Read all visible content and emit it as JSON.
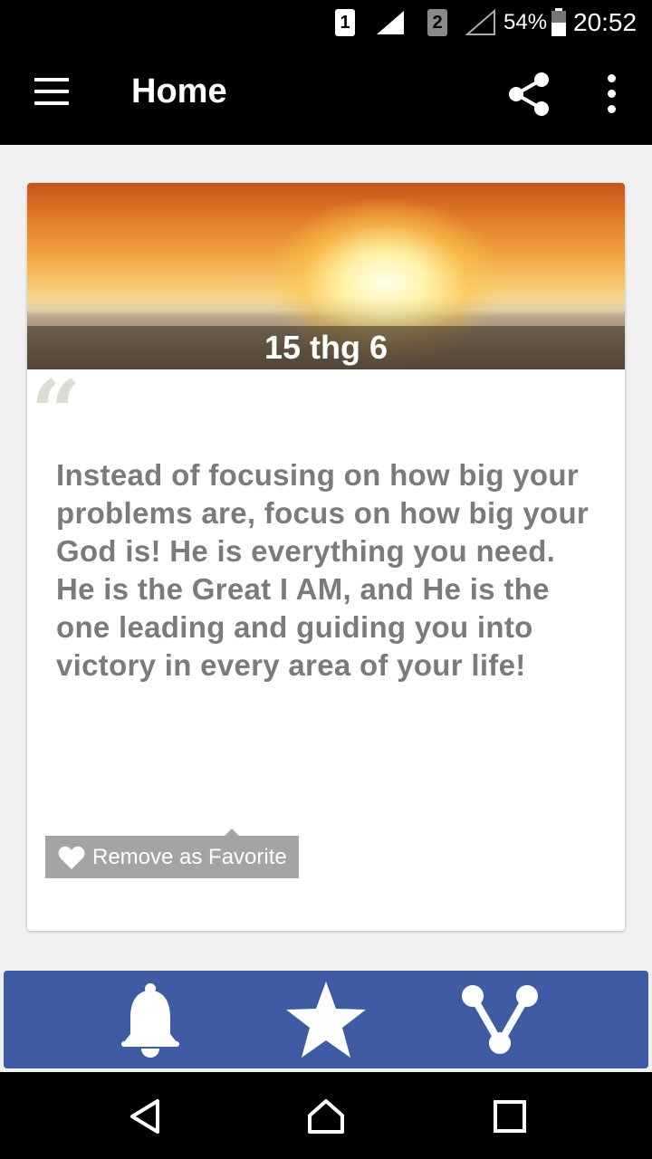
{
  "status_bar": {
    "sim1": "1",
    "sim2": "2",
    "battery": "54%",
    "time": "20:52"
  },
  "app_bar": {
    "title": "Home",
    "icons": [
      "menu-icon",
      "share-icon",
      "more-vert-icon"
    ]
  },
  "card": {
    "date": "15 thg 6",
    "quote": "Instead of focusing on how big your problems are, focus on how big your God is! He is everything you need. He is the Great I AM, and He is the one leading and guiding you into victory in every area of your life!",
    "favorite_label": "Remove as Favorite"
  },
  "bottom_toolbar": {
    "icons": [
      "bell-icon",
      "star-icon",
      "share-nodes-icon"
    ]
  },
  "nav_bar": {
    "icons": [
      "back-icon",
      "home-icon",
      "recents-icon"
    ]
  },
  "colors": {
    "app_bar": "#000000",
    "toolbar": "#3f5ba3",
    "quote_text": "#7b7b7b",
    "favorite_button": "#a4a4a4",
    "background": "#f1f1f1"
  }
}
